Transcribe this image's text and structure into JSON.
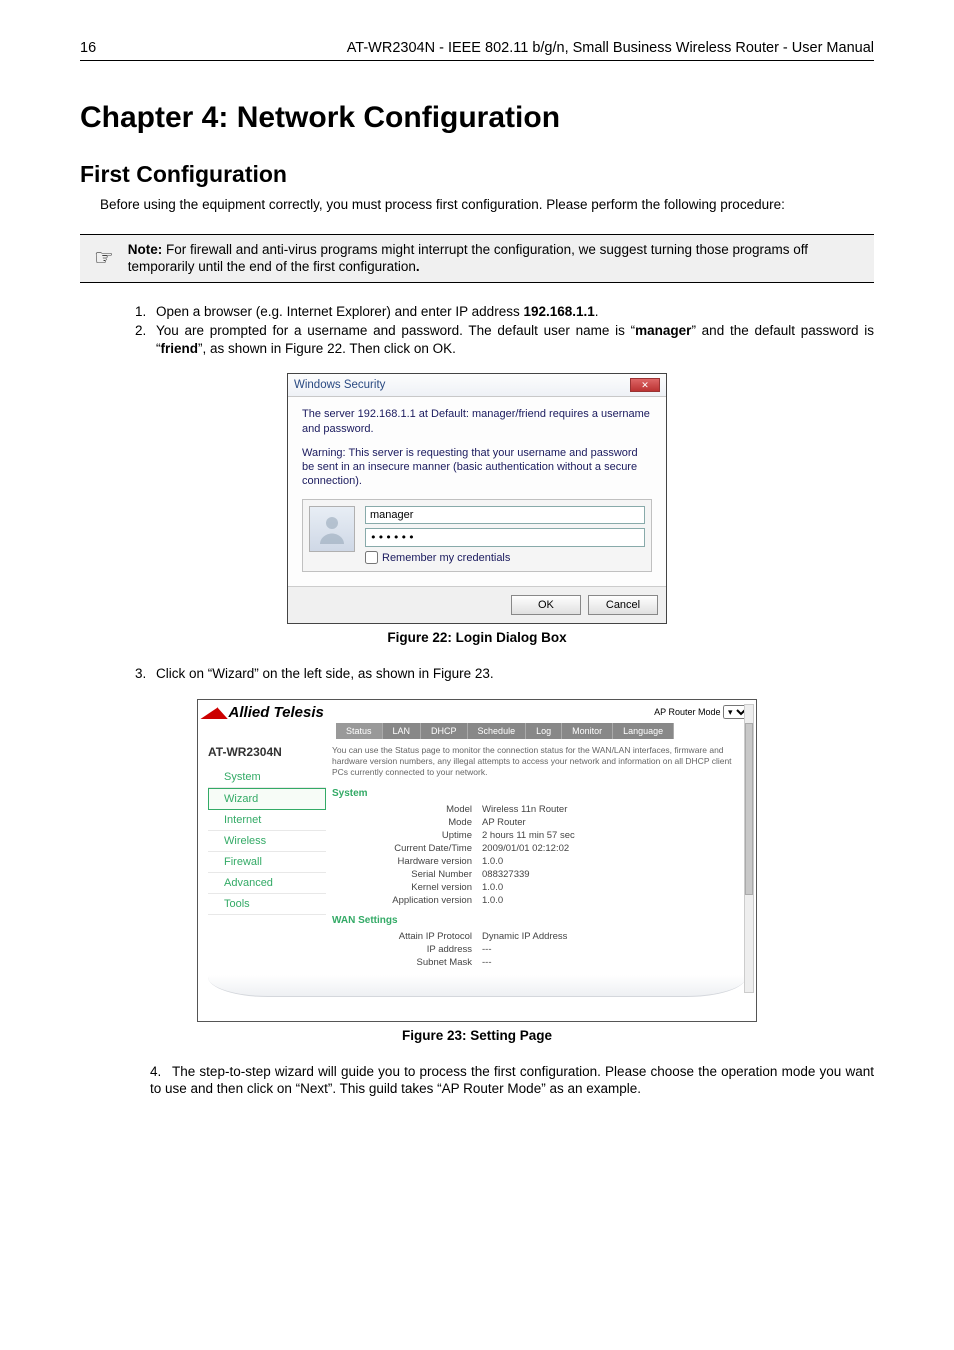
{
  "page_number": "16",
  "doc_title": "AT-WR2304N - IEEE 802.11 b/g/n, Small Business Wireless Router - User Manual",
  "chapter_title": "Chapter 4: Network Configuration",
  "section_title": "First Configuration",
  "section_intro": "Before using the equipment correctly, you must process first configuration. Please perform the following procedure:",
  "note_icon": "☞",
  "note_label": "Note:",
  "note_text": " For firewall and anti-virus programs might interrupt the configuration, we suggest turning those programs off temporarily until the end of the first configuration",
  "note_period": ".",
  "step1_a": "Open a browser (e.g. Internet Explorer) and enter IP address ",
  "step1_ip": "192.168.1.1",
  "step1_b": ".",
  "step2_a": "You are prompted for a username and password. The default user name is “",
  "step2_user": "manager",
  "step2_b": "” and the default password is “",
  "step2_pw": "friend",
  "step2_c": "”, as shown in Figure 22. Then click on OK.",
  "win": {
    "title": "Windows Security",
    "line1": "The server 192.168.1.1 at Default: manager/friend requires a username and password.",
    "line2": "Warning: This server is requesting that your username and password be sent in an insecure manner (basic authentication without a secure connection).",
    "username": "manager",
    "password": "••••••",
    "remember": "Remember my credentials",
    "ok": "OK",
    "cancel": "Cancel"
  },
  "fig22": "Figure 22: Login Dialog Box",
  "step3": "Click on “Wizard” on the left side, as shown in Figure 23.",
  "router": {
    "brand": "Allied Telesis",
    "apmode_label": "AP Router Mode",
    "menu": [
      "Status",
      "LAN",
      "DHCP",
      "Schedule",
      "Log",
      "Monitor",
      "Language"
    ],
    "model": "AT-WR2304N",
    "side": [
      "System",
      "Wizard",
      "Internet",
      "Wireless",
      "Firewall",
      "Advanced",
      "Tools"
    ],
    "desc": "You can use the Status page to monitor the connection status for the WAN/LAN interfaces, firmware and hardware version numbers, any illegal attempts to access your network and information on all DHCP client PCs currently connected to your network.",
    "sys_head": "System",
    "sys": {
      "Model": "Wireless 11n Router",
      "Mode": "AP Router",
      "Uptime": "2 hours 11 min 57 sec",
      "Current Date/Time": "2009/01/01 02:12:02",
      "Hardware version": "1.0.0",
      "Serial Number": "088327339",
      "Kernel version": "1.0.0",
      "Application version": "1.0.0"
    },
    "wan_head": "WAN Settings",
    "wan": {
      "Attain IP Protocol": "Dynamic IP Address",
      "IP address": "---",
      "Subnet Mask": "---"
    }
  },
  "fig23": "Figure 23: Setting Page",
  "step4": "The step-to-step wizard will guide you to process the first configuration. Please choose the operation mode you want to use and then click on “Next”. This guild takes “AP Router Mode” as an example."
}
